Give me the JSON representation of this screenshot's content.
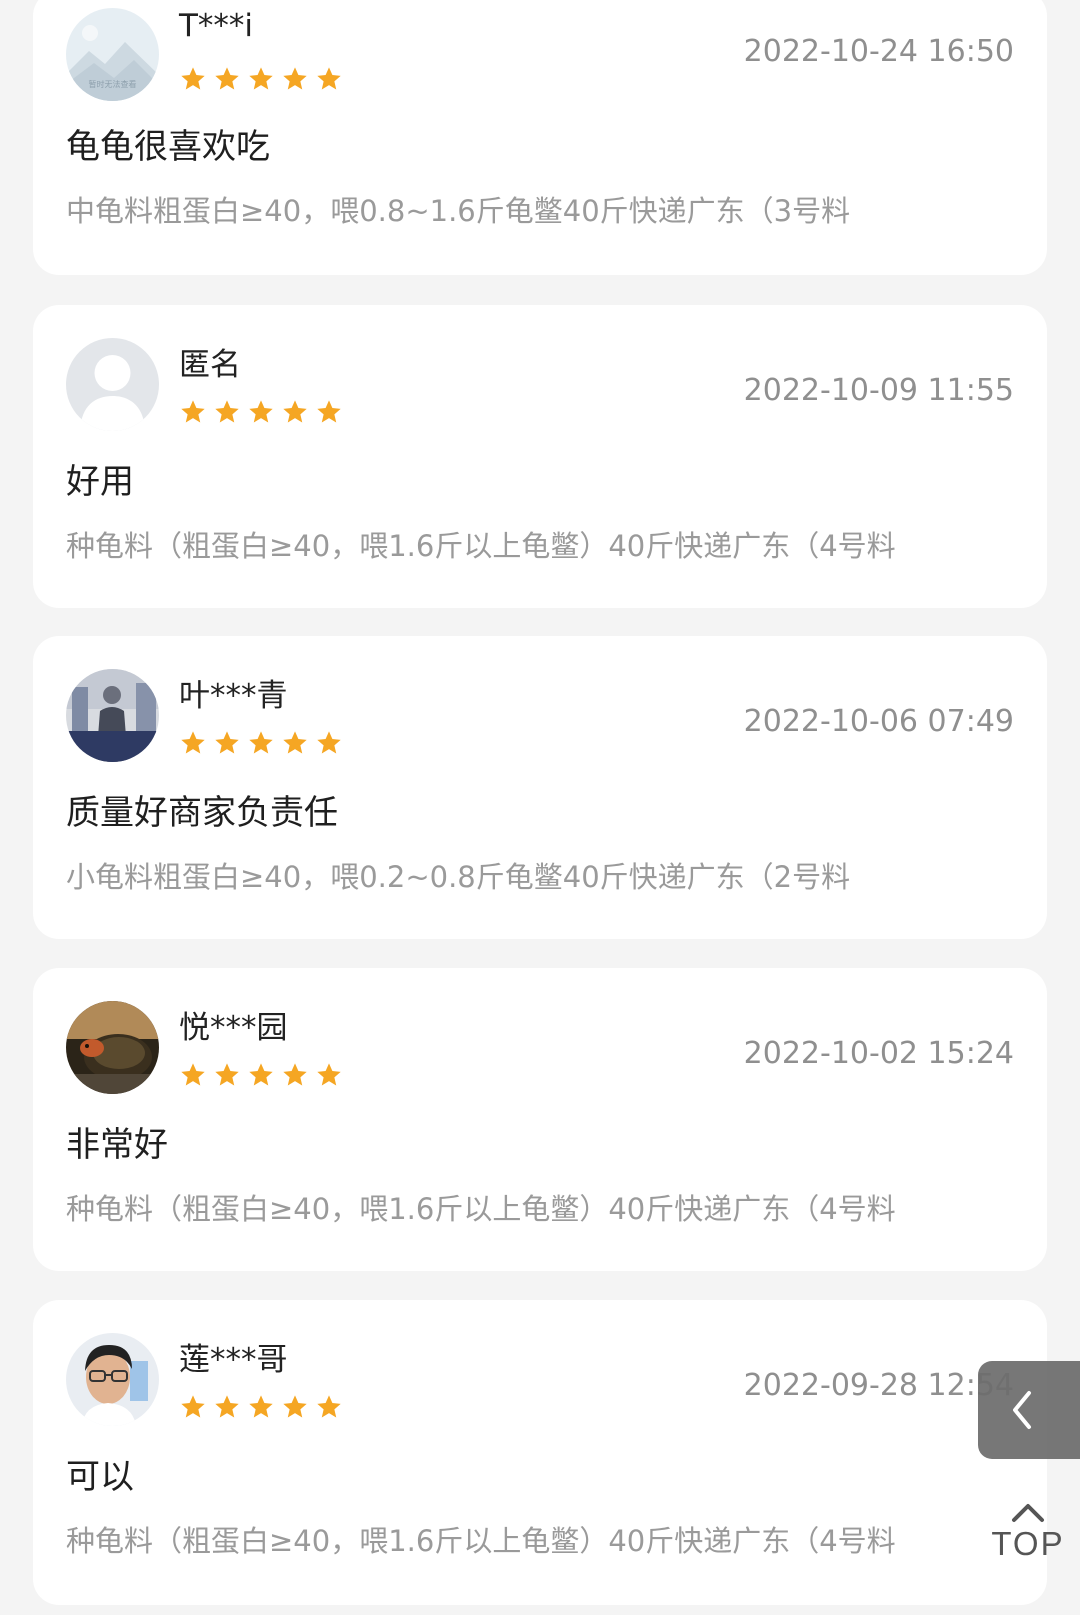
{
  "reviews": [
    {
      "username": "T***i",
      "rating": 5,
      "timestamp": "2022-10-24 16:50",
      "comment": "龟龟很喜欢吃",
      "spec": "中龟料粗蛋白≥40，喂0.8~1.6斤龟鳖40斤快递广东（3号料",
      "avatar_icon": "placeholder-image-icon",
      "avatar_text": "暂时无法查看"
    },
    {
      "username": "匿名",
      "rating": 5,
      "timestamp": "2022-10-09 11:55",
      "comment": "好用",
      "spec": "种龟料（粗蛋白≥40，喂1.6斤以上龟鳖）40斤快递广东（4号料",
      "avatar_icon": "anonymous-user-icon"
    },
    {
      "username": "叶***青",
      "rating": 5,
      "timestamp": "2022-10-06 07:49",
      "comment": "质量好商家负责任",
      "spec": "小龟料粗蛋白≥40，喂0.2~0.8斤龟鳖40斤快递广东（2号料",
      "avatar_icon": "user-photo-icon"
    },
    {
      "username": "悦***园",
      "rating": 5,
      "timestamp": "2022-10-02 15:24",
      "comment": "非常好",
      "spec": "种龟料（粗蛋白≥40，喂1.6斤以上龟鳖）40斤快递广东（4号料",
      "avatar_icon": "turtle-photo-icon"
    },
    {
      "username": "莲***哥",
      "rating": 5,
      "timestamp": "2022-09-28 12:54",
      "comment": "可以",
      "spec": "种龟料（粗蛋白≥40，喂1.6斤以上龟鳖）40斤快递广东（4号料",
      "avatar_icon": "man-photo-icon"
    }
  ],
  "floating": {
    "back_icon": "chevron-left-icon",
    "top_label": "TOP",
    "top_icon": "chevron-up-icon"
  },
  "colors": {
    "star": "#f5a623",
    "page_background": "#f4f4f4",
    "card_background": "#ffffff",
    "muted_text": "#9a9a9a"
  }
}
